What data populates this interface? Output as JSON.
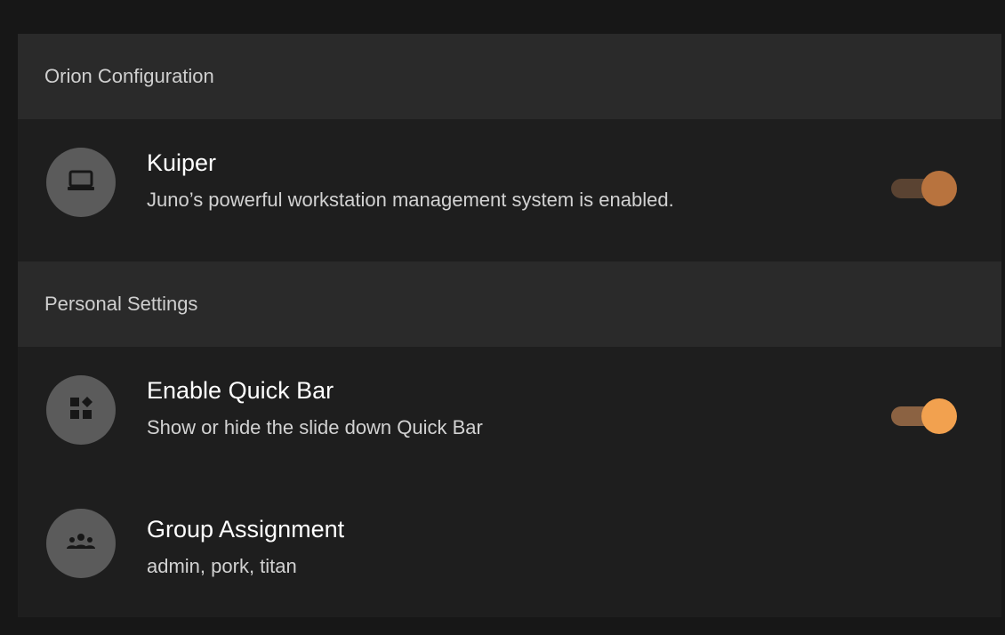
{
  "sections": [
    {
      "header": "Orion Configuration",
      "items": [
        {
          "title": "Kuiper",
          "subtitle": "Juno’s powerful workstation management system is enabled.",
          "icon": "laptop-icon",
          "toggle": {
            "state": "on",
            "track_color": "#5a4332",
            "thumb_color": "#b8733e"
          }
        }
      ]
    },
    {
      "header": "Personal Settings",
      "items": [
        {
          "title": "Enable Quick Bar",
          "subtitle": "Show or hide the slide down Quick Bar",
          "icon": "widgets-icon",
          "toggle": {
            "state": "on",
            "track_color": "#8b6242",
            "thumb_color": "#f2a14f"
          }
        },
        {
          "title": "Group Assignment",
          "subtitle": "admin, pork, titan",
          "icon": "group-icon"
        }
      ]
    }
  ],
  "colors": {
    "page_background": "#171717",
    "panel_background": "#1e1e1e",
    "section_header_background": "#2a2a2a",
    "icon_circle": "#5b5b5b",
    "accent": "#f2a14f"
  }
}
